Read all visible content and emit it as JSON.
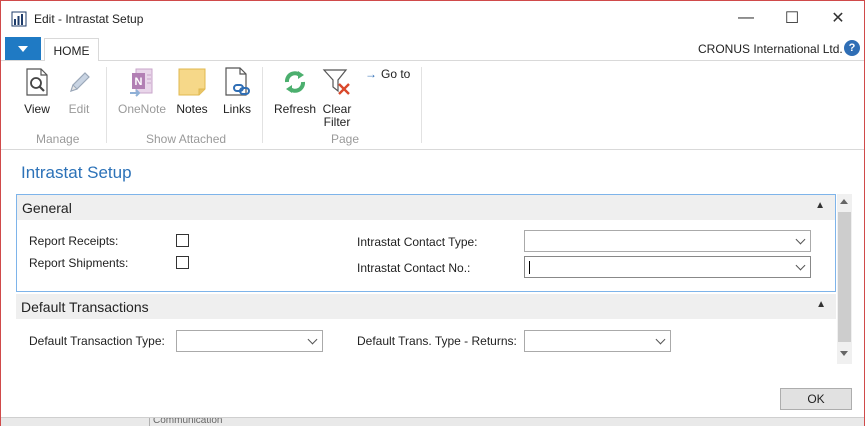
{
  "window": {
    "title": "Edit - Intrastat Setup",
    "minimize_glyph": "—",
    "maximize_glyph": "☐",
    "close_glyph": "✕"
  },
  "tabstrip": {
    "home_tab": "HOME",
    "company": "CRONUS International Ltd.",
    "help_glyph": "?"
  },
  "ribbon": {
    "manage": {
      "label": "Manage",
      "view": "View",
      "edit": "Edit"
    },
    "show_attached": {
      "label": "Show Attached",
      "onenote": "OneNote",
      "notes": "Notes",
      "links": "Links"
    },
    "page": {
      "label": "Page",
      "refresh": "Refresh",
      "clear_filter_line1": "Clear",
      "clear_filter_line2": "Filter",
      "go_to": "Go to"
    }
  },
  "page_title": "Intrastat Setup",
  "general": {
    "title": "General",
    "report_receipts_label": "Report Receipts:",
    "report_receipts_checked": false,
    "report_shipments_label": "Report Shipments:",
    "report_shipments_checked": false,
    "contact_type_label": "Intrastat Contact Type:",
    "contact_type_value": "",
    "contact_no_label": "Intrastat Contact No.:",
    "contact_no_value": ""
  },
  "default_transactions": {
    "title": "Default Transactions",
    "transaction_type_label": "Default Transaction Type:",
    "transaction_type_value": "",
    "returns_label": "Default Trans. Type - Returns:",
    "returns_value": ""
  },
  "ok_button": "OK",
  "background_peek": "Communication",
  "colors": {
    "accent": "#2c72b8",
    "app_menu": "#1f7ac4",
    "window_border": "#d04a4a",
    "focus_border": "#7eb4ea"
  }
}
